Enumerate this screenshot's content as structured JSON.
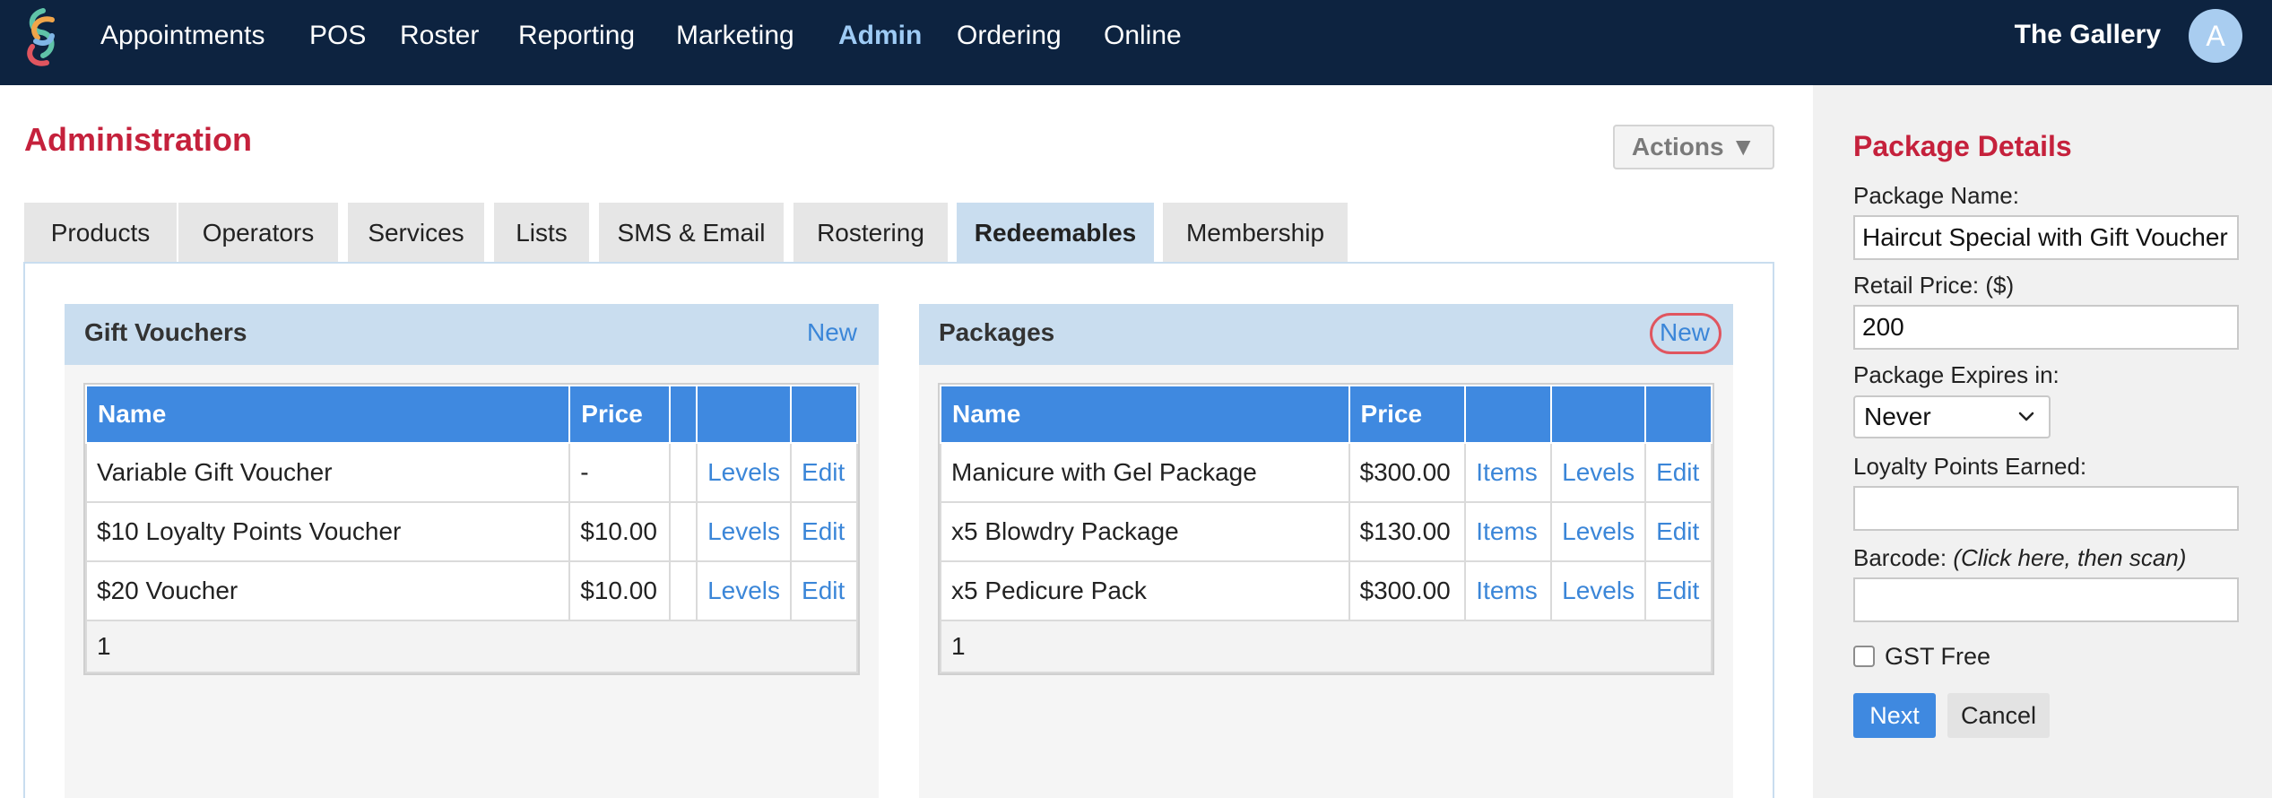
{
  "nav": {
    "logo_icon": "swirl-logo-icon",
    "items": [
      {
        "label": "Appointments"
      },
      {
        "label": "POS"
      },
      {
        "label": "Roster"
      },
      {
        "label": "Reporting"
      },
      {
        "label": "Marketing"
      },
      {
        "label": "Admin"
      },
      {
        "label": "Ordering"
      },
      {
        "label": "Online"
      }
    ],
    "active": "Admin",
    "venue": "The Gallery",
    "avatar_initial": "A"
  },
  "page": {
    "title": "Administration",
    "actions_label": "Actions ▼"
  },
  "tabs": [
    {
      "label": "Products"
    },
    {
      "label": "Operators"
    },
    {
      "label": "Services"
    },
    {
      "label": "Lists"
    },
    {
      "label": "SMS & Email"
    },
    {
      "label": "Rostering"
    },
    {
      "label": "Redeemables"
    },
    {
      "label": "Membership"
    }
  ],
  "active_tab": "Redeemables",
  "gift_vouchers": {
    "title": "Gift Vouchers",
    "new_label": "New",
    "columns": [
      "Name",
      "Price",
      "",
      "",
      ""
    ],
    "rows": [
      {
        "name": "Variable Gift Voucher",
        "price": "-",
        "levels": "Levels",
        "edit": "Edit"
      },
      {
        "name": "$10 Loyalty Points Voucher",
        "price": "$10.00",
        "levels": "Levels",
        "edit": "Edit"
      },
      {
        "name": "$20 Voucher",
        "price": "$10.00",
        "levels": "Levels",
        "edit": "Edit"
      }
    ],
    "page": "1"
  },
  "packages": {
    "title": "Packages",
    "new_label": "New",
    "columns": [
      "Name",
      "Price",
      "",
      "",
      ""
    ],
    "rows": [
      {
        "name": "Manicure with Gel Package",
        "price": "$300.00",
        "items": "Items",
        "levels": "Levels",
        "edit": "Edit"
      },
      {
        "name": "x5 Blowdry Package",
        "price": "$130.00",
        "items": "Items",
        "levels": "Levels",
        "edit": "Edit"
      },
      {
        "name": "x5 Pedicure Pack",
        "price": "$300.00",
        "items": "Items",
        "levels": "Levels",
        "edit": "Edit"
      }
    ],
    "page": "1"
  },
  "package_details": {
    "title": "Package Details",
    "name_label": "Package Name:",
    "name_value": "Haircut Special with Gift Voucher",
    "price_label": "Retail Price: ($)",
    "price_value": "200",
    "expires_label": "Package Expires in:",
    "expires_value": "Never",
    "loyalty_label": "Loyalty Points Earned:",
    "loyalty_value": "",
    "barcode_label": "Barcode:",
    "barcode_hint": "(Click here, then scan)",
    "barcode_value": "",
    "gst_label": "GST Free",
    "gst_checked": false,
    "next_label": "Next",
    "cancel_label": "Cancel"
  },
  "colors": {
    "nav_bg": "#0d2340",
    "accent_red": "#c5213c",
    "link_blue": "#3b86d8",
    "header_blue": "#3f89e0",
    "panel_header": "#c9ddef"
  }
}
